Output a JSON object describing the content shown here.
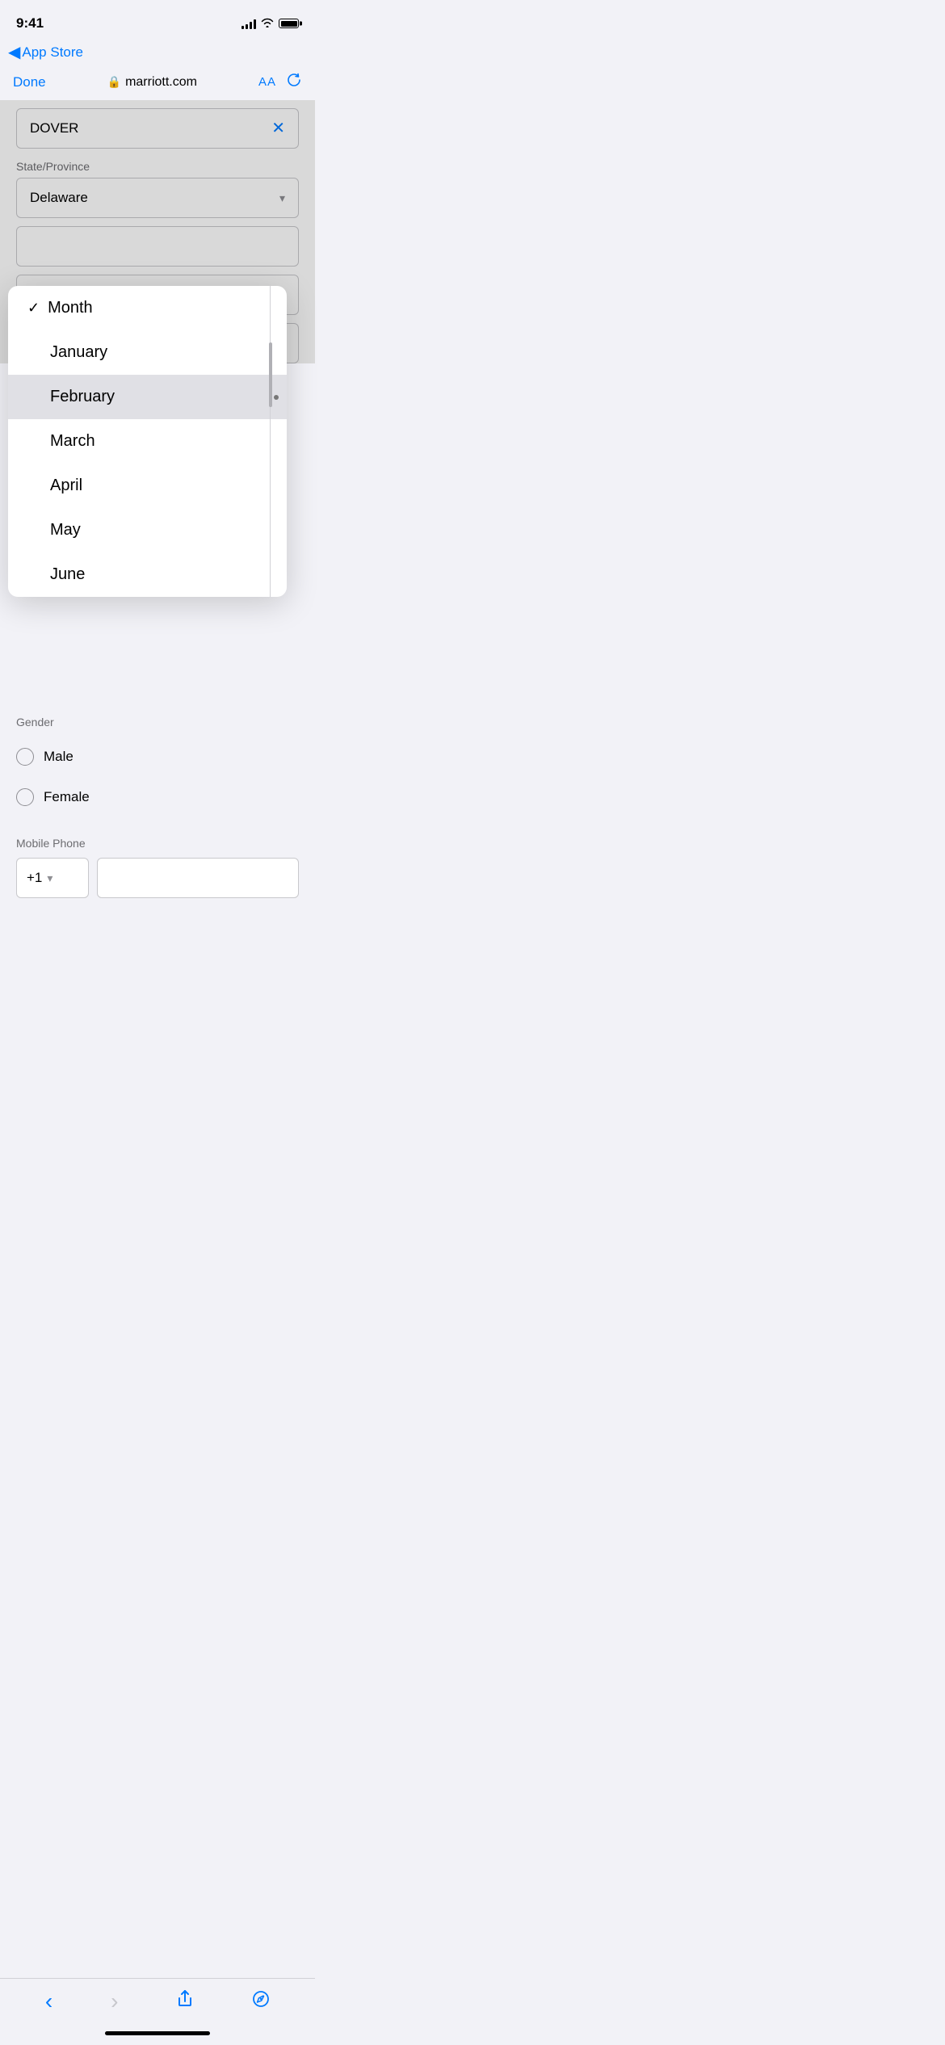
{
  "statusBar": {
    "time": "9:41",
    "signalBars": [
      4,
      6,
      8,
      10,
      12
    ],
    "wifi": "wifi",
    "battery": "full"
  },
  "backNav": {
    "arrow": "◀",
    "label": "App Store"
  },
  "browserBar": {
    "done": "Done",
    "lock": "🔒",
    "url": "marriott.com",
    "aa": "AA",
    "reload": "↻"
  },
  "form": {
    "cityValue": "DOVER",
    "clearBtn": "✕",
    "stateLabel": "State/Province",
    "stateValue": "Delaware",
    "dropdown": {
      "items": [
        {
          "id": "month",
          "text": "Month",
          "checked": true,
          "highlighted": false
        },
        {
          "id": "january",
          "text": "January",
          "checked": false,
          "highlighted": false
        },
        {
          "id": "february",
          "text": "February",
          "checked": false,
          "highlighted": true
        },
        {
          "id": "march",
          "text": "March",
          "checked": false,
          "highlighted": false
        },
        {
          "id": "april",
          "text": "April",
          "checked": false,
          "highlighted": false
        },
        {
          "id": "may",
          "text": "May",
          "checked": false,
          "highlighted": false
        },
        {
          "id": "june",
          "text": "June",
          "checked": false,
          "highlighted": false
        }
      ]
    },
    "genderLabel": "Gender",
    "genderOptions": [
      {
        "id": "male",
        "label": "Male",
        "selected": false
      },
      {
        "id": "female",
        "label": "Female",
        "selected": false
      }
    ],
    "phoneLabel": "Mobile Phone",
    "countryCode": "+1",
    "phonePlaceholder": ""
  },
  "safariNav": {
    "back": "‹",
    "forward": "›",
    "share": "share",
    "compass": "compass"
  }
}
